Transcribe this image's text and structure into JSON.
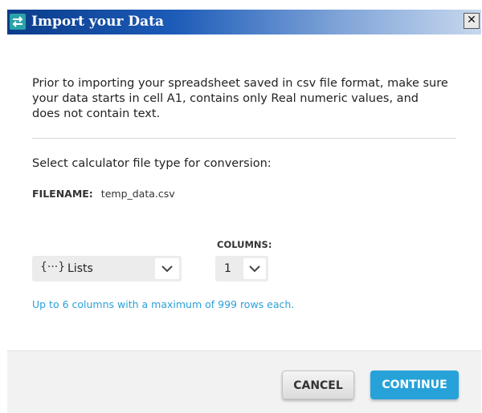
{
  "window": {
    "title": "Import your Data",
    "close_glyph": "✕",
    "icon": "import-swap-icon"
  },
  "content": {
    "instructions": "Prior to importing your spreadsheet saved in csv file format, make sure your data starts in cell A1, contains only Real numeric values, and does not contain text.",
    "select_label": "Select calculator file type for conversion:",
    "filename_key": "FILENAME:",
    "filename_value": "temp_data.csv",
    "columns_label": "COLUMNS:",
    "file_type": {
      "icon_glyph": "{···}",
      "selected": "Lists"
    },
    "columns": {
      "selected": "1"
    },
    "hint": "Up to 6 columns with a maximum of 999 rows each."
  },
  "footer": {
    "cancel_label": "CANCEL",
    "continue_label": "CONTINUE"
  },
  "colors": {
    "accent": "#27a2d9",
    "title_bar": "#0b3c8a",
    "hint_text": "#2aa0d8"
  }
}
